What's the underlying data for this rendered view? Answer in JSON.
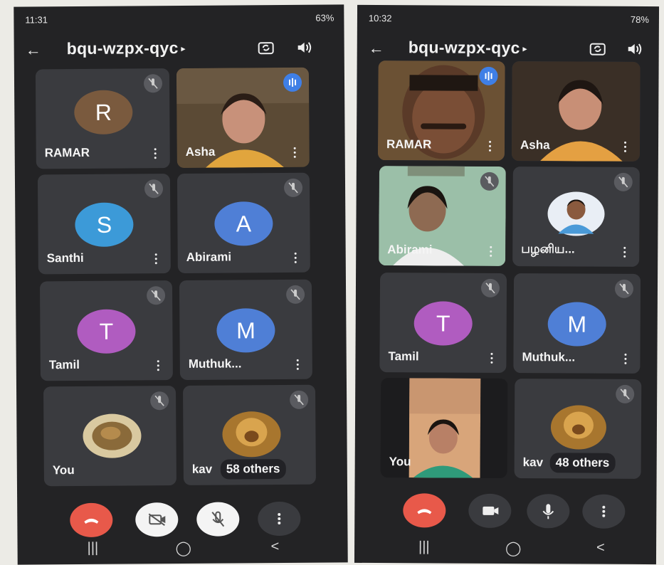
{
  "left": {
    "status": {
      "time": "11:31",
      "battery": "63%"
    },
    "meeting_code": "bqu-wzpx-qyc",
    "tiles": [
      {
        "name": "RAMAR",
        "initial": "R",
        "color": "#7a5a3e",
        "kind": "avatar"
      },
      {
        "name": "Asha",
        "kind": "photo",
        "speaking": true
      },
      {
        "name": "Santhi",
        "initial": "S",
        "color": "#3c9ad8",
        "kind": "avatar"
      },
      {
        "name": "Abirami",
        "initial": "A",
        "color": "#4f7fd6",
        "kind": "avatar"
      },
      {
        "name": "Tamil",
        "initial": "T",
        "color": "#b05cc0",
        "kind": "avatar"
      },
      {
        "name": "Muthuk...",
        "initial": "M",
        "color": "#4f7fd6",
        "kind": "avatar"
      },
      {
        "name": "You",
        "kind": "photo"
      },
      {
        "name": "kav",
        "kind": "photo",
        "others": "58 others"
      }
    ]
  },
  "right": {
    "status": {
      "time": "10:32",
      "battery": "78%"
    },
    "meeting_code": "bqu-wzpx-qyc",
    "tiles": [
      {
        "name": "RAMAR",
        "kind": "photo",
        "speaking": true
      },
      {
        "name": "Asha",
        "kind": "photo"
      },
      {
        "name": "Abirami",
        "kind": "photo"
      },
      {
        "name": "பழனிய...",
        "kind": "photo"
      },
      {
        "name": "Tamil",
        "initial": "T",
        "color": "#b05cc0",
        "kind": "avatar"
      },
      {
        "name": "Muthuk...",
        "initial": "M",
        "color": "#4f7fd6",
        "kind": "avatar"
      },
      {
        "name": "You",
        "kind": "photo"
      },
      {
        "name": "kav",
        "kind": "photo",
        "others": "48 others"
      }
    ]
  },
  "icons": {
    "back": "arrow-back-icon",
    "camera_flip": "camera-flip-icon",
    "speaker": "speaker-icon",
    "end_call": "end-call-icon",
    "camera": "camera-icon",
    "mic": "mic-icon",
    "more": "more-vert-icon"
  }
}
